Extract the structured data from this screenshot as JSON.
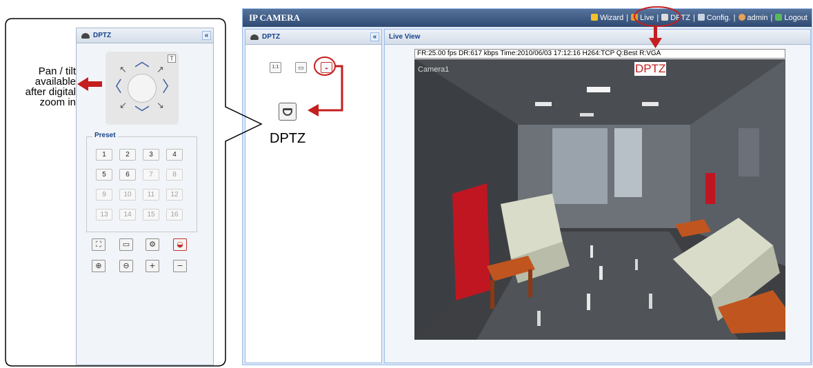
{
  "callout": {
    "text_line1": "Pan / tilt",
    "text_line2": "available",
    "text_line3": "after digital",
    "text_line4": "zoom in"
  },
  "left_panel": {
    "title": "DPTZ",
    "collapse": "«",
    "ptz_pad": {
      "up": "︿",
      "down": "﹀",
      "left": "〈",
      "right": "〉",
      "tele_label": "T"
    },
    "preset": {
      "legend": "Preset",
      "buttons": [
        {
          "label": "1",
          "enabled": true
        },
        {
          "label": "2",
          "enabled": true
        },
        {
          "label": "3",
          "enabled": true
        },
        {
          "label": "4",
          "enabled": true
        },
        {
          "label": "5",
          "enabled": true
        },
        {
          "label": "6",
          "enabled": true
        },
        {
          "label": "7",
          "enabled": false
        },
        {
          "label": "8",
          "enabled": false
        },
        {
          "label": "9",
          "enabled": false
        },
        {
          "label": "10",
          "enabled": false
        },
        {
          "label": "11",
          "enabled": false
        },
        {
          "label": "12",
          "enabled": false
        },
        {
          "label": "13",
          "enabled": false
        },
        {
          "label": "14",
          "enabled": false
        },
        {
          "label": "15",
          "enabled": false
        },
        {
          "label": "16",
          "enabled": false
        }
      ]
    },
    "tools_row1": [
      "fullscreen-icon",
      "snapshot-icon",
      "settings-icon",
      "dptz-icon"
    ],
    "tools_row2": [
      "zoom-in-icon",
      "zoom-out-icon",
      "plus-icon",
      "minus-icon"
    ]
  },
  "app": {
    "title": "IP CAMERA",
    "nav": [
      {
        "label": "Wizard",
        "icon": "wizard-icon"
      },
      {
        "label": "Live",
        "icon": "live-icon"
      },
      {
        "label": "DPTZ",
        "icon": "dptz-icon"
      },
      {
        "label": "Config.",
        "icon": "config-icon"
      },
      {
        "label": "admin",
        "icon": "user-icon"
      },
      {
        "label": "Logout",
        "icon": "logout-icon"
      }
    ],
    "nav_separator": "|",
    "side_panel": {
      "title": "DPTZ",
      "collapse": "«",
      "buttons": [
        {
          "label": "1:1",
          "icon": "actual-size-icon"
        },
        {
          "label": "",
          "icon": "snapshot-icon"
        },
        {
          "label": "",
          "icon": "dptz-icon"
        }
      ],
      "big_label": "DPTZ"
    },
    "main_panel": {
      "title": "Live View",
      "info_bar": "FR:25.00 fps  DR:617 kbps Time:2010/06/03 17:12:16 H264:TCP Q:Best R:VGA",
      "camera_name": "Camera1",
      "annotation": "DPTZ"
    }
  },
  "colors": {
    "annotation_red": "#c41e1e",
    "header_blue": "#15428b",
    "topbar": "#2f4a72",
    "panel_border": "#99bbe8"
  }
}
